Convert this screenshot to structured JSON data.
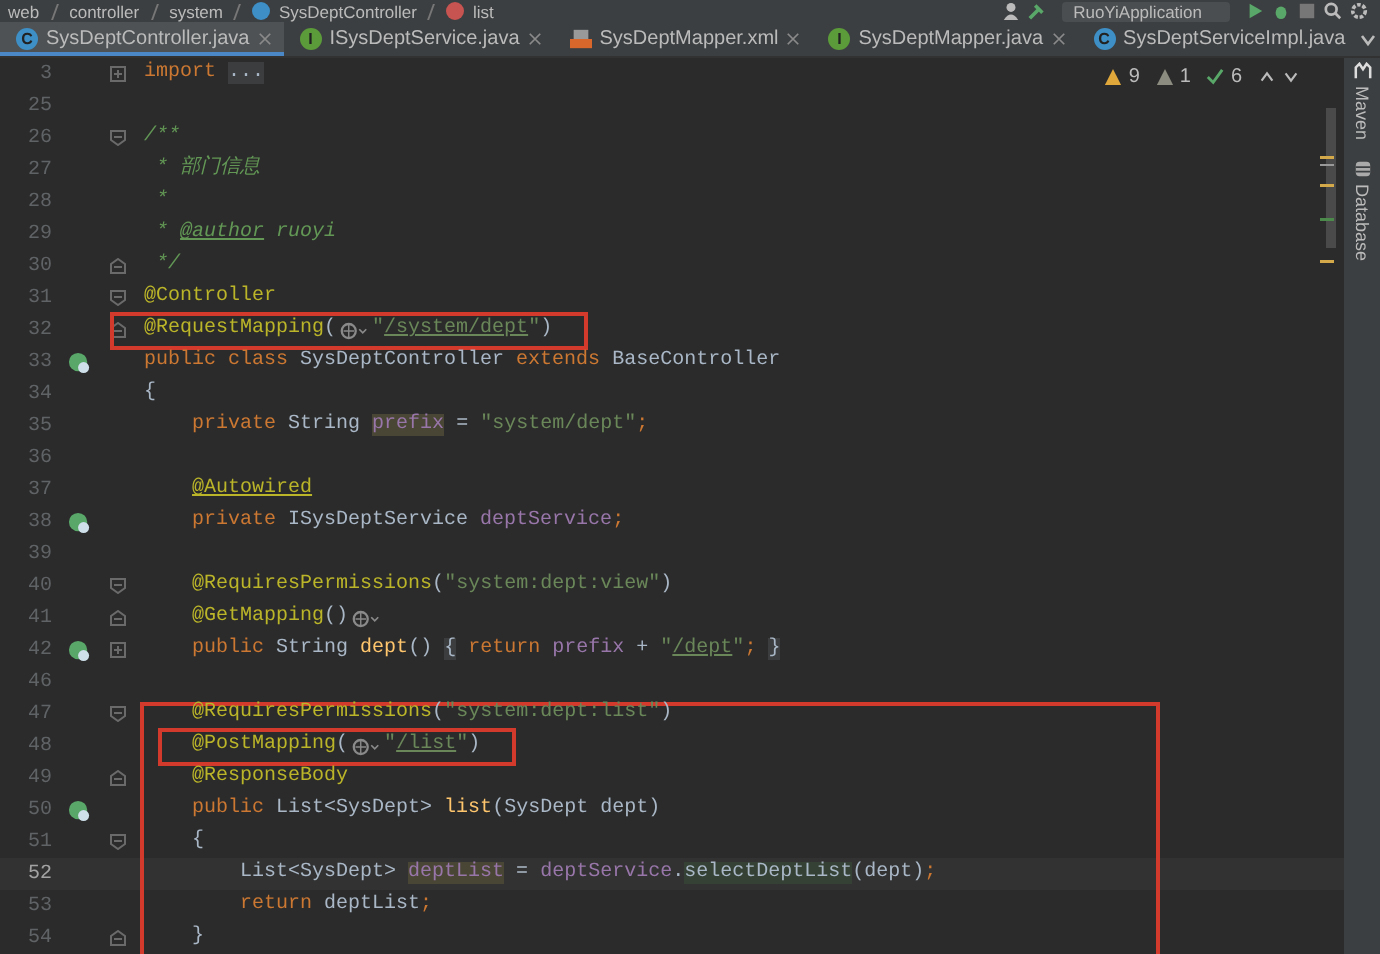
{
  "breadcrumb": [
    {
      "label": "web",
      "kind": "folder"
    },
    {
      "label": "controller",
      "kind": "folder"
    },
    {
      "label": "system",
      "kind": "folder"
    },
    {
      "label": "SysDeptController",
      "kind": "class"
    },
    {
      "label": "list",
      "kind": "method"
    }
  ],
  "run_config": "RuoYiApplication",
  "tabs": [
    {
      "label": "SysDeptController.java",
      "kind": "class",
      "icon_letter": "C",
      "selected": true,
      "closable": true
    },
    {
      "label": "ISysDeptService.java",
      "kind": "interface",
      "icon_letter": "I",
      "selected": false,
      "closable": true
    },
    {
      "label": "SysDeptMapper.xml",
      "kind": "xml",
      "selected": false,
      "closable": true
    },
    {
      "label": "SysDeptMapper.java",
      "kind": "interface",
      "icon_letter": "I",
      "selected": false,
      "closable": true
    },
    {
      "label": "SysDeptServiceImpl.java",
      "kind": "class",
      "icon_letter": "C",
      "selected": false,
      "closable": false
    }
  ],
  "inspections": {
    "warnings": "9",
    "weak_warnings": "1",
    "typos": "6"
  },
  "tool_windows": [
    {
      "label": "Maven",
      "kind": "maven"
    },
    {
      "label": "Database",
      "kind": "database"
    }
  ],
  "editor": {
    "sections": [
      {
        "lines": [
          {
            "number": "3",
            "collapsed": true,
            "tokens": [
              {
                "kind": "keyword",
                "text": "import"
              },
              {
                "kind": "folded",
                "text": "..."
              }
            ]
          },
          {
            "number": "25"
          },
          {
            "number": "26",
            "fold_open": true,
            "tokens": [
              {
                "kind": "doc",
                "text": "/**"
              }
            ]
          },
          {
            "number": "27",
            "tokens": [
              {
                "kind": "doc",
                "text": " * 部门信息"
              }
            ]
          },
          {
            "number": "28",
            "tokens": [
              {
                "kind": "doc",
                "text": " *"
              }
            ]
          },
          {
            "number": "29",
            "tokens": [
              {
                "kind": "doc",
                "text": " * "
              },
              {
                "kind": "doc-tag",
                "text": "@author"
              },
              {
                "kind": "doc",
                "text": " ruoyi"
              }
            ]
          },
          {
            "number": "30",
            "fold_close": true,
            "tokens": [
              {
                "kind": "doc",
                "text": " */"
              }
            ]
          },
          {
            "number": "31",
            "fold_open": true,
            "tokens": [
              {
                "kind": "annotation",
                "text": "@Controller"
              }
            ]
          },
          {
            "number": "32",
            "fold_close": true,
            "boxed": true,
            "tokens": [
              {
                "kind": "annotation",
                "text": "@RequestMapping"
              },
              {
                "kind": "plain",
                "text": "("
              },
              {
                "kind": "hint"
              },
              {
                "kind": "string",
                "text": "\""
              },
              {
                "kind": "link",
                "text": "/system/dept"
              },
              {
                "kind": "string",
                "text": "\""
              },
              {
                "kind": "plain",
                "text": ")"
              }
            ]
          },
          {
            "number": "33",
            "bean_marker": true,
            "tokens": [
              {
                "kind": "keyword",
                "text": "public class "
              },
              {
                "kind": "plain",
                "text": "SysDeptController "
              },
              {
                "kind": "keyword",
                "text": "extends "
              },
              {
                "kind": "plain",
                "text": "BaseController"
              }
            ]
          },
          {
            "number": "34",
            "tokens": [
              {
                "kind": "plain",
                "text": "{"
              }
            ]
          },
          {
            "number": "35",
            "tokens": [
              {
                "kind": "keyword",
                "text": "    private "
              },
              {
                "kind": "plain",
                "text": "String "
              },
              {
                "kind": "field-hl",
                "text": "prefix"
              },
              {
                "kind": "plain",
                "text": " = "
              },
              {
                "kind": "string",
                "text": "\"system/dept\""
              },
              {
                "kind": "keyword",
                "text": ";"
              }
            ]
          },
          {
            "number": "36"
          },
          {
            "number": "37",
            "tokens": [
              {
                "kind": "annotation-u",
                "text": "    @Autowired"
              }
            ]
          },
          {
            "number": "38",
            "bean_marker": true,
            "tokens": [
              {
                "kind": "keyword",
                "text": "    private "
              },
              {
                "kind": "plain",
                "text": "ISysDeptService "
              },
              {
                "kind": "field",
                "text": "deptService"
              },
              {
                "kind": "keyword",
                "text": ";"
              }
            ]
          },
          {
            "number": "39"
          },
          {
            "number": "40",
            "fold_open": true,
            "tokens": [
              {
                "kind": "annotation",
                "text": "    @RequiresPermissions"
              },
              {
                "kind": "plain",
                "text": "("
              },
              {
                "kind": "string",
                "text": "\"system:dept:view\""
              },
              {
                "kind": "plain",
                "text": ")"
              }
            ]
          },
          {
            "number": "41",
            "fold_close": true,
            "tokens": [
              {
                "kind": "annotation",
                "text": "    @GetMapping"
              },
              {
                "kind": "plain",
                "text": "()"
              },
              {
                "kind": "hint"
              }
            ]
          },
          {
            "number": "42",
            "bean_marker": true,
            "collapsed": true,
            "tokens": [
              {
                "kind": "keyword",
                "text": "    public "
              },
              {
                "kind": "plain",
                "text": "String "
              },
              {
                "kind": "method",
                "text": "dept"
              },
              {
                "kind": "plain",
                "text": "() "
              },
              {
                "kind": "brace",
                "text": "{"
              },
              {
                "kind": "keyword",
                "text": " return "
              },
              {
                "kind": "field",
                "text": "prefix"
              },
              {
                "kind": "plain",
                "text": " + "
              },
              {
                "kind": "string",
                "text": "\""
              },
              {
                "kind": "link",
                "text": "/dept"
              },
              {
                "kind": "string",
                "text": "\""
              },
              {
                "kind": "keyword",
                "text": "; "
              },
              {
                "kind": "brace",
                "text": "}"
              }
            ]
          },
          {
            "number": "46"
          }
        ]
      },
      {
        "framed": true,
        "lines": [
          {
            "number": "47",
            "fold_open": true,
            "tokens": [
              {
                "kind": "annotation",
                "text": "    @RequiresPermissions"
              },
              {
                "kind": "plain",
                "text": "("
              },
              {
                "kind": "string",
                "text": "\"system:dept:list\""
              },
              {
                "kind": "plain",
                "text": ")"
              }
            ]
          },
          {
            "number": "48",
            "boxed": true,
            "tokens": [
              {
                "kind": "annotation",
                "text": "    @PostMapping"
              },
              {
                "kind": "plain",
                "text": "("
              },
              {
                "kind": "hint"
              },
              {
                "kind": "string",
                "text": "\""
              },
              {
                "kind": "link",
                "text": "/list"
              },
              {
                "kind": "string",
                "text": "\""
              },
              {
                "kind": "plain",
                "text": ")"
              }
            ]
          },
          {
            "number": "49",
            "fold_close": true,
            "tokens": [
              {
                "kind": "annotation",
                "text": "    @ResponseBody"
              }
            ]
          },
          {
            "number": "50",
            "bean_marker": true,
            "tokens": [
              {
                "kind": "keyword",
                "text": "    public "
              },
              {
                "kind": "plain",
                "text": "List<SysDept> "
              },
              {
                "kind": "method",
                "text": "list"
              },
              {
                "kind": "plain",
                "text": "(SysDept dept)"
              }
            ]
          },
          {
            "number": "51",
            "fold_open": true,
            "tokens": [
              {
                "kind": "plain",
                "text": "    {"
              }
            ]
          },
          {
            "number": "52",
            "current": true,
            "tokens": [
              {
                "kind": "plain",
                "text": "        List<SysDept> "
              },
              {
                "kind": "field-hl",
                "text": "deptList"
              },
              {
                "kind": "plain",
                "text": " = "
              },
              {
                "kind": "field",
                "text": "deptService"
              },
              {
                "kind": "plain",
                "text": "."
              },
              {
                "kind": "method-hl",
                "text": "selectDeptList"
              },
              {
                "kind": "plain",
                "text": "(dept)"
              },
              {
                "kind": "keyword",
                "text": ";"
              }
            ]
          },
          {
            "number": "53",
            "tokens": [
              {
                "kind": "keyword",
                "text": "        return "
              },
              {
                "kind": "plain",
                "text": "deptList"
              },
              {
                "kind": "keyword",
                "text": ";"
              }
            ]
          },
          {
            "number": "54",
            "fold_close": true,
            "tokens": [
              {
                "kind": "plain",
                "text": "    }"
              }
            ]
          }
        ]
      }
    ]
  }
}
